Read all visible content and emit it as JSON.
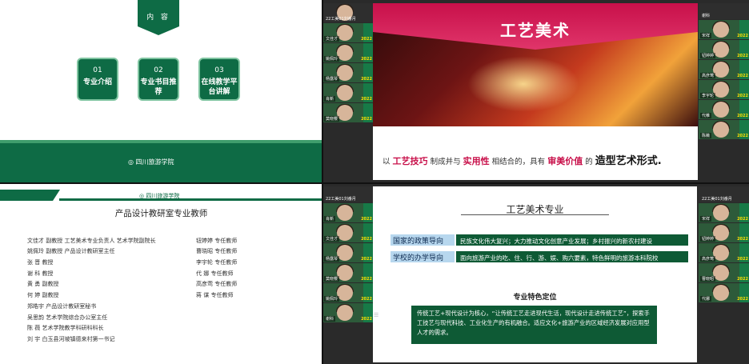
{
  "q1": {
    "tab": "内 容",
    "items": [
      {
        "num": "01",
        "label": "专业介绍"
      },
      {
        "num": "02",
        "label": "专业书目推荐"
      },
      {
        "num": "03",
        "label": "在线教学平台讲解"
      }
    ],
    "logo": "四川旅游学院"
  },
  "q2": {
    "participants_left": [
      {
        "name": "22工美01刘番月"
      },
      {
        "name": "文佳才"
      },
      {
        "name": "姚佩玲"
      },
      {
        "name": "杨露琴"
      },
      {
        "name": "肖新"
      },
      {
        "name": "莫晓樱"
      }
    ],
    "participants_right": [
      {
        "name": "谢科"
      },
      {
        "name": "宋祥"
      },
      {
        "name": "钮婷婷"
      },
      {
        "name": "高彦莺"
      },
      {
        "name": "李宇轮"
      },
      {
        "name": "代帷"
      },
      {
        "name": "陈薇"
      }
    ],
    "year": "2022",
    "slide": {
      "title": "工艺美术",
      "sentence": {
        "p1": "以",
        "r1": "工艺技巧",
        "p2": "制成并与",
        "r2": "实用性",
        "p3": "相结合的，具有",
        "r3": "审美价值",
        "p4": "的",
        "b1": "造型艺术形式."
      }
    }
  },
  "q3": {
    "logo": "四川旅游学院",
    "title": "产品设计教研室专业教师",
    "left": [
      "文佳才  副教授  工艺美术专业负责人  艺术学院副院长",
      "姚佩玲  副教授  产品设计教研室主任",
      "张  晋  教授",
      "谢  科  教授",
      "黄  勇  副教授",
      "何  婷  副教授",
      "郑皓宇  产品设计教研室秘书",
      "吴思韵  艺术学院综合办公室主任",
      "陈  薇  艺术学院教学科研科科长",
      "刘  宇  白玉县河坡镇德来村第一书记"
    ],
    "right": [
      "钮婷婷  专任教师",
      "曹晓昭  专任教师",
      "李宇轮  专任教师",
      "代  娜  专任教师",
      "高彦莺  专任教师",
      "蒋  谋  专任教师"
    ]
  },
  "q4": {
    "participants_left": [
      {
        "name": "22工美01刘番月"
      },
      {
        "name": "肖新"
      },
      {
        "name": "文佳才"
      },
      {
        "name": "杨露琴"
      },
      {
        "name": "莫晓樱"
      },
      {
        "name": "姚佩玲"
      },
      {
        "name": "谢科"
      }
    ],
    "participants_right": [
      {
        "name": "22工美01刘番月"
      },
      {
        "name": "宋祥"
      },
      {
        "name": "钮婷婷"
      },
      {
        "name": "高彦莺"
      },
      {
        "name": "曹晓昭"
      },
      {
        "name": "代娜"
      }
    ],
    "slide": {
      "title": "工艺美术专业",
      "row1_label": "国家的政策导向",
      "row1_text": "民族文化伟大复兴；大力推动文化创意产业发展；乡村振兴的新农村建设",
      "row2_label": "学校的办学导向",
      "row2_text": "面向旅游产业的吃、住、行、游、娱、购六要素，特色鲜明的旅游本科院校",
      "subtitle": "专业特色定位",
      "box": "传统工艺+现代设计为核心，“让传统工艺走进现代生活，现代设计走进传统工艺”，探索手工技艺与现代科技、工业化生产的有机融合。适应文化+旅游产业的区域经济发展对应用型人才的需求。"
    }
  }
}
